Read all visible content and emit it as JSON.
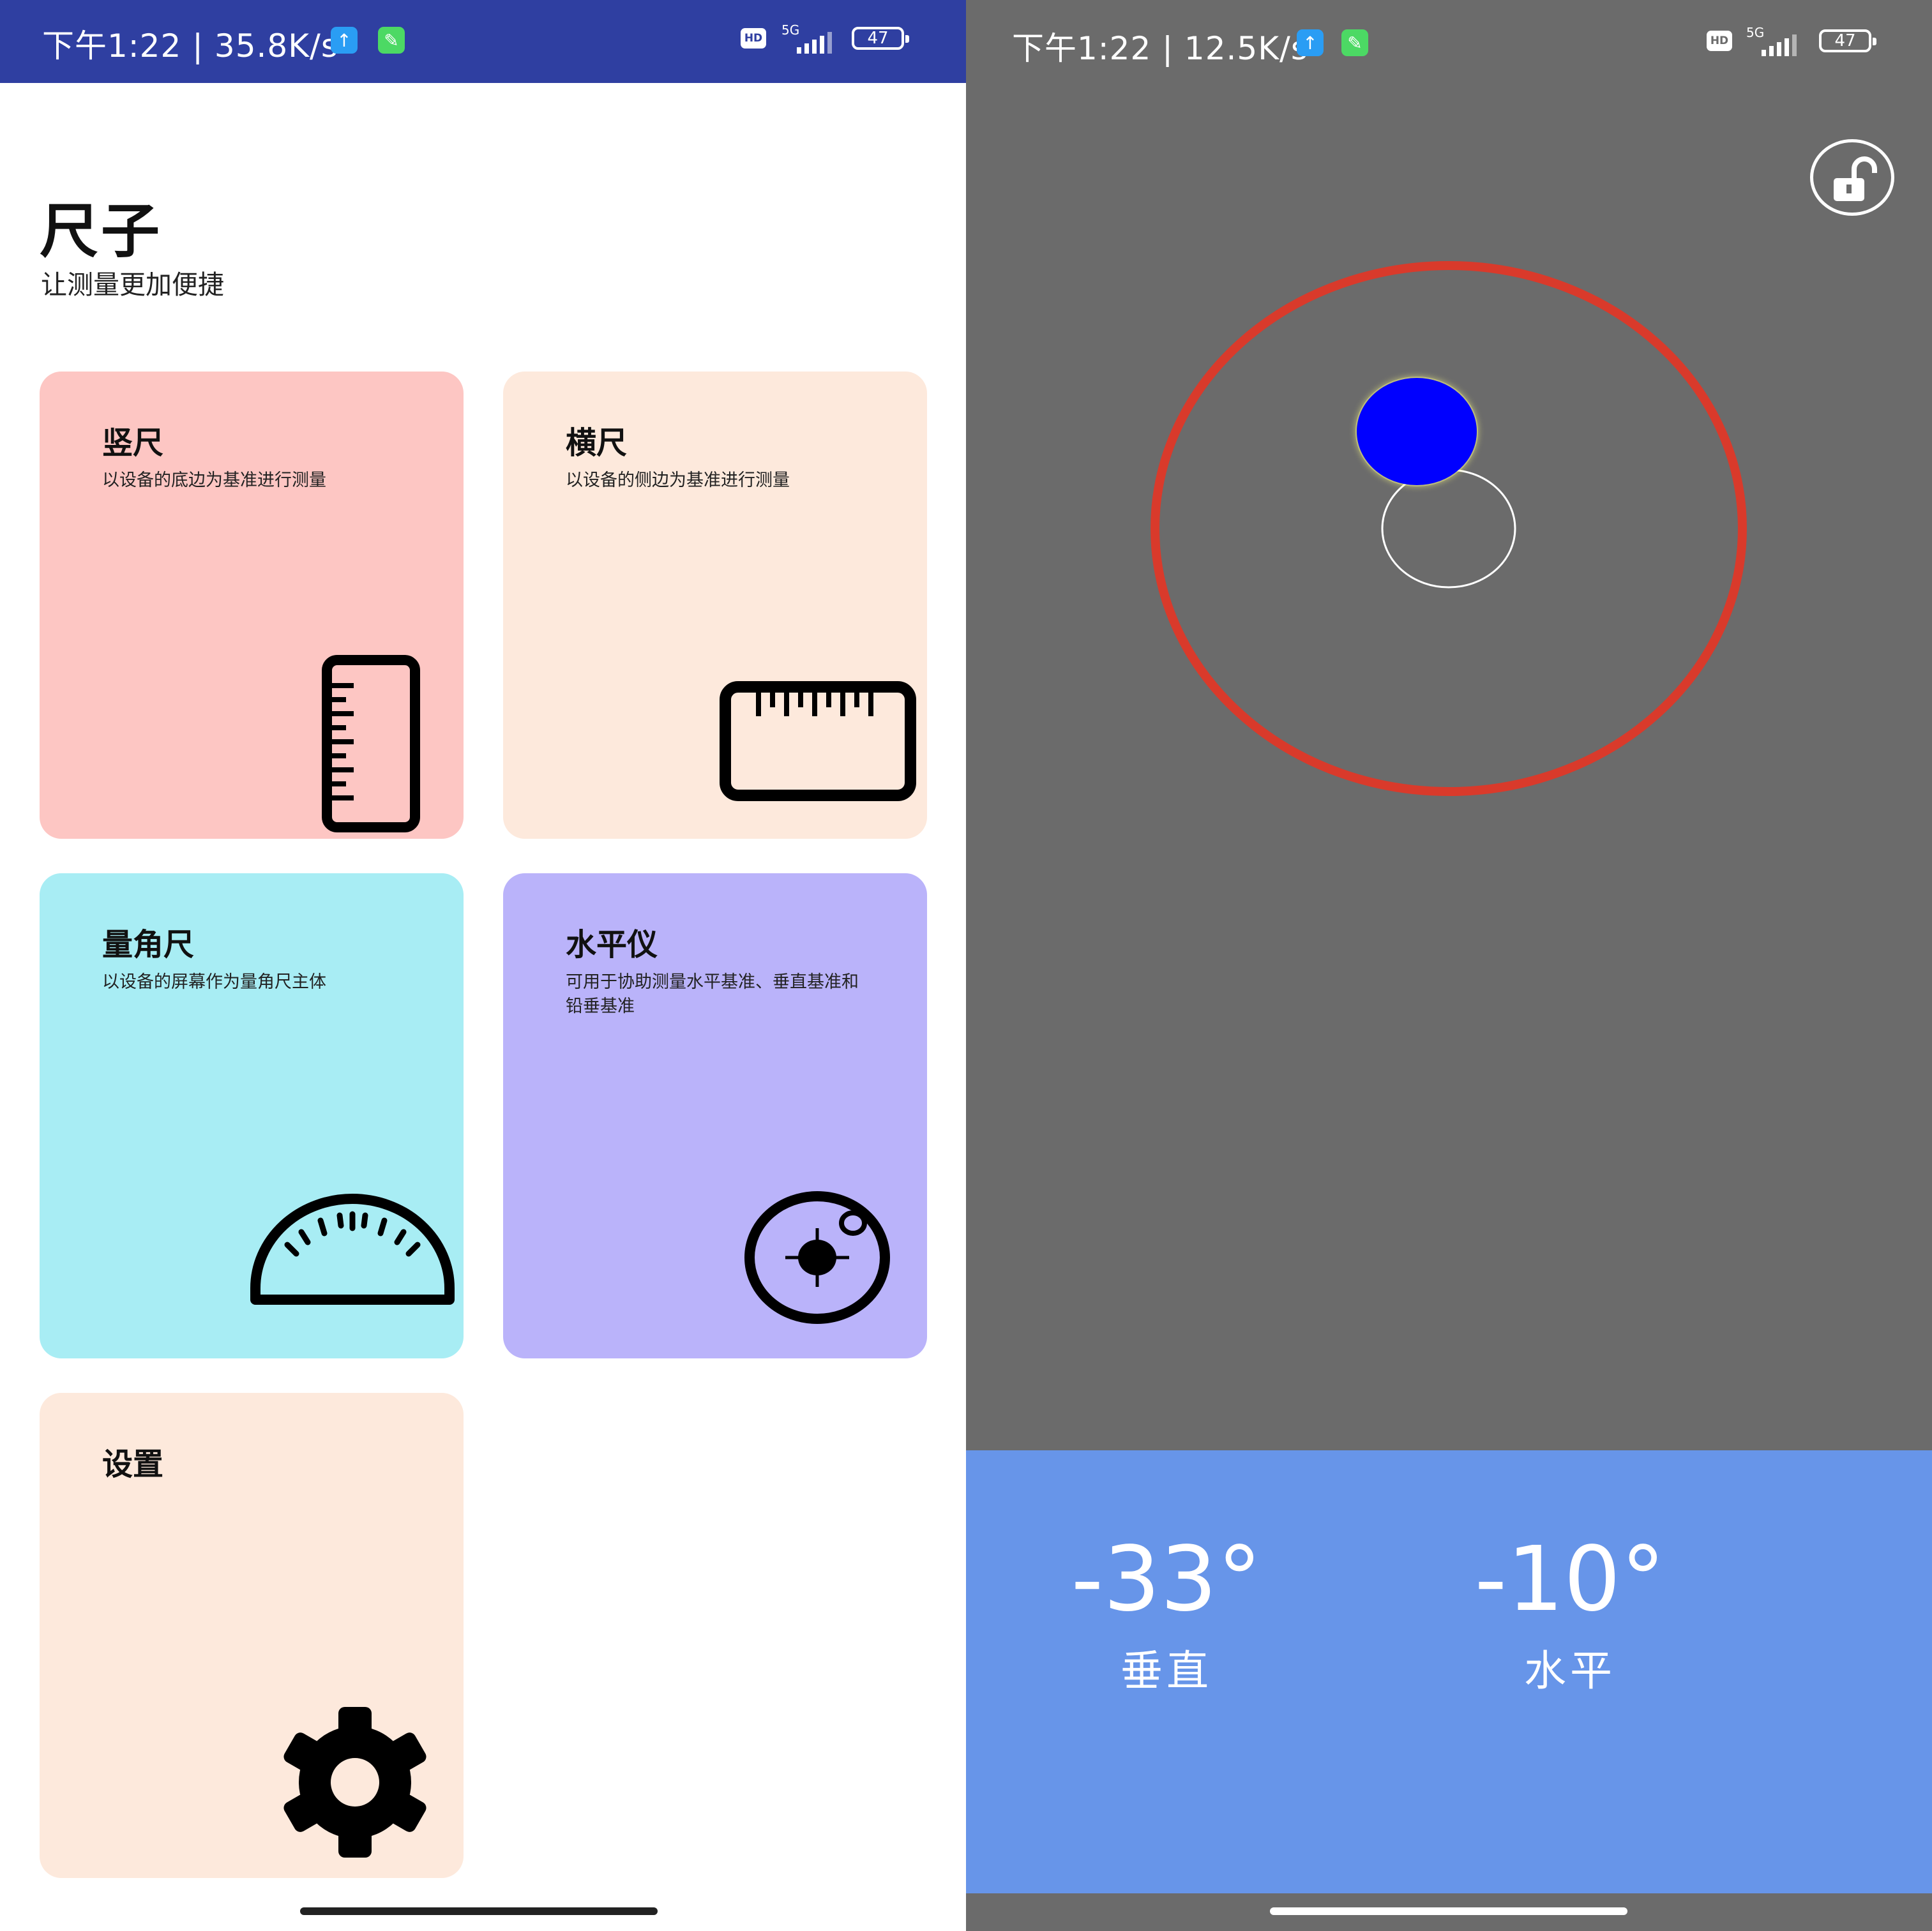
{
  "left_screen": {
    "status_bar": {
      "time_speed": "下午1:22 | 35.8K/s",
      "network_type": "5G",
      "battery": "47",
      "hd_label": "HD",
      "icons": [
        "upload-icon",
        "wrench-icon",
        "signal-icon",
        "battery-icon"
      ]
    },
    "app": {
      "title": "尺子",
      "subtitle": "让测量更加便捷"
    },
    "cards": [
      {
        "title": "竖尺",
        "desc": "以设备的底边为基准进行测量",
        "icon": "vertical-ruler-icon",
        "color": "#fdc6c3"
      },
      {
        "title": "横尺",
        "desc": "以设备的侧边为基准进行测量",
        "icon": "horizontal-ruler-icon",
        "color": "#fde9dc"
      },
      {
        "title": "量角尺",
        "desc": "以设备的屏幕作为量角尺主体",
        "icon": "protractor-icon",
        "color": "#a8edf4"
      },
      {
        "title": "水平仪",
        "desc": "可用于协助测量水平基准、垂直基准和铅垂基准",
        "icon": "level-icon",
        "color": "#bab3fa"
      },
      {
        "title": "设置",
        "desc": "",
        "icon": "gear-icon",
        "color": "#fde9dc"
      }
    ]
  },
  "right_screen": {
    "status_bar": {
      "time_speed": "下午1:22 | 12.5K/s",
      "network_type": "5G",
      "battery": "47",
      "hd_label": "HD"
    },
    "lock_icon": "unlock-icon",
    "level": {
      "bubble_color": "#0000ff",
      "ring_color": "#d93a2b"
    },
    "readouts": [
      {
        "value": "-33°",
        "label": "垂直"
      },
      {
        "value": "-10°",
        "label": "水平"
      }
    ],
    "panel_color": "#6795e9"
  }
}
